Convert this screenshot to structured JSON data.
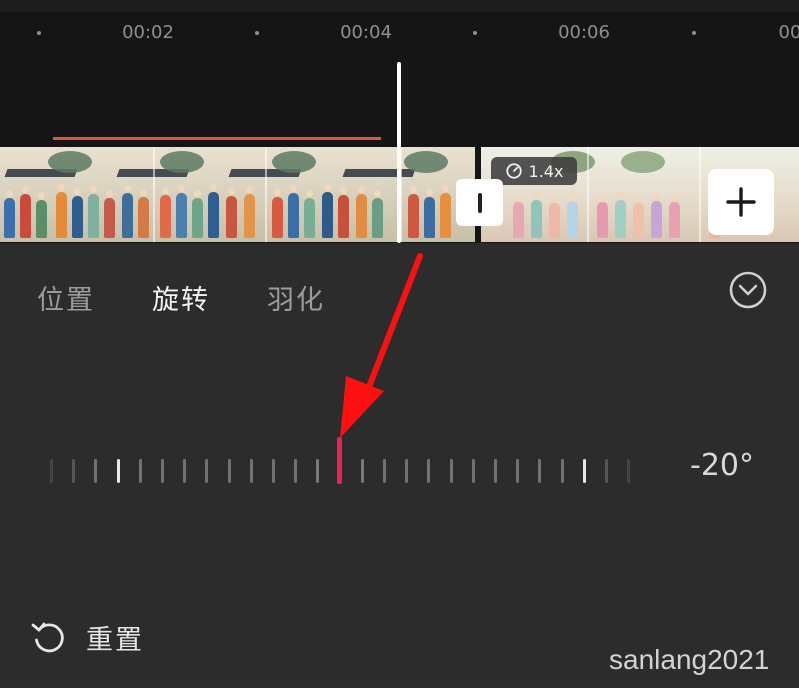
{
  "timeline": {
    "time_labels": [
      "00:02",
      "00:04",
      "00:06",
      "00"
    ],
    "speed_badge": "1.4x",
    "add_clip_symbol": "+"
  },
  "panel": {
    "tabs": [
      {
        "label": "位置",
        "active": false
      },
      {
        "label": "旋转",
        "active": true
      },
      {
        "label": "羽化",
        "active": false
      }
    ],
    "collapse_icon": "chevron-down-circle-icon",
    "rotation": {
      "angle_label": "-20°"
    },
    "reset_label": "重置"
  },
  "annotation": {
    "arrow_color": "#ff1010"
  },
  "watermark": "sanlang2021",
  "colors": {
    "accent_indicator": "#ef1f5a",
    "audio_line": "#e2553d",
    "timeline_bg": "#151515",
    "panel_bg": "#2c2c2c"
  }
}
